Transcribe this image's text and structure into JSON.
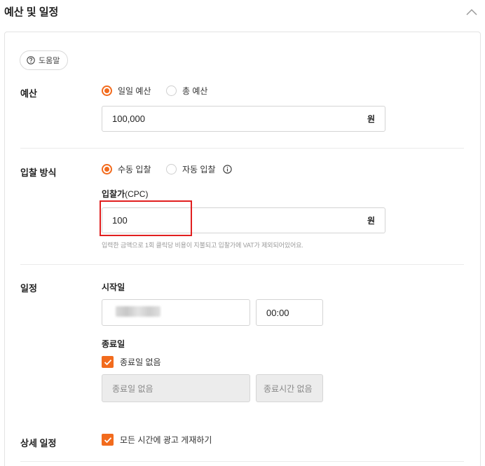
{
  "section": {
    "title": "예산 및 일정"
  },
  "help": {
    "label": "도움말"
  },
  "budget": {
    "label": "예산",
    "options": [
      {
        "label": "일일 예산",
        "selected": true
      },
      {
        "label": "총 예산",
        "selected": false
      }
    ],
    "value": "100,000",
    "unit": "원"
  },
  "bidding": {
    "label": "입찰 방식",
    "options": [
      {
        "label": "수동 입찰",
        "selected": true
      },
      {
        "label": "자동 입찰",
        "selected": false
      }
    ],
    "bid_label_bold": "입찰가",
    "bid_label_light": "(CPC)",
    "bid_value": "100",
    "unit": "원",
    "hint": "입력한 금액으로 1회 클릭당 비용이 지불되고 입찰가에 VAT가 제외되어있어요."
  },
  "schedule": {
    "label": "일정",
    "start_label": "시작일",
    "start_time": "00:00",
    "end_label": "종료일",
    "no_end_checkbox": {
      "label": "종료일 없음",
      "checked": true
    },
    "end_date_placeholder": "종료일 없음",
    "end_time_placeholder": "종료시간 없음"
  },
  "detail_schedule": {
    "label": "상세 일정",
    "all_time_checkbox": {
      "label": "모든 시간에 광고 게재하기",
      "checked": true
    }
  },
  "colors": {
    "accent": "#f26b1d",
    "highlight": "#e11f1f"
  }
}
